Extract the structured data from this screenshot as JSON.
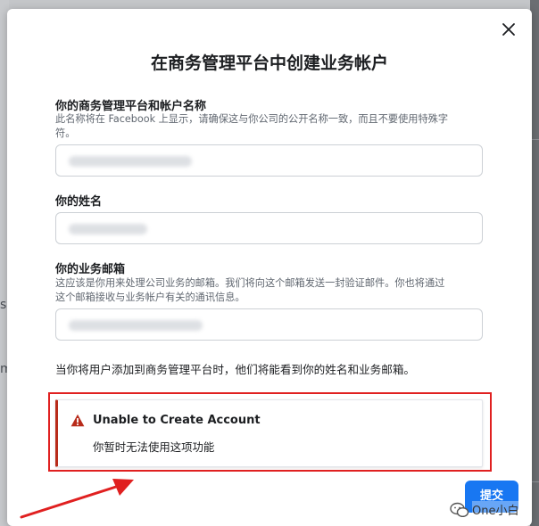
{
  "dialog": {
    "title": "在商务管理平台中创建业务帐户",
    "close_icon": "close-icon"
  },
  "form": {
    "business_name": {
      "label": "你的商务管理平台和帐户名称",
      "help_line1": "此名称将在 Facebook 上显示，请确保这与你公司的公开名称一致，而且不要使用特殊字",
      "help_line2": "符。",
      "value": ""
    },
    "your_name": {
      "label": "你的姓名",
      "value": ""
    },
    "business_email": {
      "label": "你的业务邮箱",
      "help_line1": "这应该是你用来处理公司业务的邮箱。我们将向这个邮箱发送一封验证邮件。你也将通过",
      "help_line2": "这个邮箱接收与业务帐户有关的通讯信息。",
      "value": ""
    },
    "notice": "当你将用户添加到商务管理平台时，他们将能看到你的姓名和业务邮箱。"
  },
  "alert": {
    "icon": "warning-icon",
    "title": "Unable to Create Account",
    "message": "你暂时无法使用这项功能"
  },
  "footer": {
    "submit_label": "提交"
  },
  "watermark": {
    "text": "One小白"
  },
  "colors": {
    "primary": "#1877f2",
    "alert_accent": "#b82b1a",
    "highlight_box": "#e02020"
  }
}
